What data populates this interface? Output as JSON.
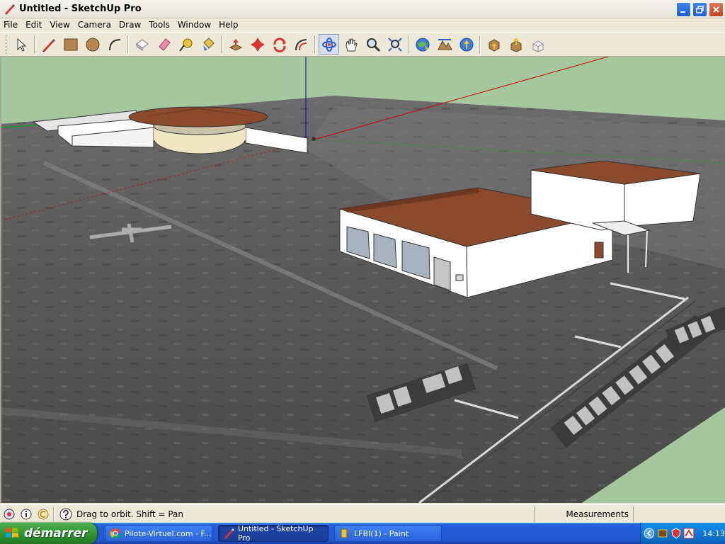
{
  "window": {
    "title": "Untitled - SketchUp Pro",
    "controls": [
      "minimize",
      "maximize",
      "close"
    ]
  },
  "menu": {
    "items": [
      "File",
      "Edit",
      "View",
      "Camera",
      "Draw",
      "Tools",
      "Window",
      "Help"
    ]
  },
  "toolbar": {
    "tools": [
      {
        "name": "select-icon"
      },
      {
        "name": "pencil-icon"
      },
      {
        "name": "rectangle-icon"
      },
      {
        "name": "circle-icon"
      },
      {
        "name": "arc-icon"
      },
      {
        "name": "eraser-icon"
      },
      {
        "name": "paint-eraser-icon"
      },
      {
        "name": "tape-measure-icon"
      },
      {
        "name": "paint-bucket-icon"
      },
      {
        "name": "push-pull-icon"
      },
      {
        "name": "move-icon"
      },
      {
        "name": "rotate-icon"
      },
      {
        "name": "offset-icon"
      },
      {
        "name": "orbit-icon"
      },
      {
        "name": "pan-icon"
      },
      {
        "name": "zoom-icon"
      },
      {
        "name": "zoom-extents-icon"
      },
      {
        "name": "get-current-view-icon"
      },
      {
        "name": "toggle-terrain-icon"
      },
      {
        "name": "place-model-icon"
      },
      {
        "name": "get-models-icon"
      },
      {
        "name": "share-model-icon"
      },
      {
        "name": "share-component-icon"
      }
    ],
    "active_tool": "orbit-icon"
  },
  "status": {
    "hint": "Drag to orbit.  Shift = Pan",
    "measurements_label": "Measurements",
    "measurements_value": ""
  },
  "taskbar": {
    "start_label": "démarrer",
    "tasks": [
      {
        "label": "Pilote-Virtuel.com - F...",
        "active": false
      },
      {
        "label": "Untitled - SketchUp Pro",
        "active": true
      },
      {
        "label": "LFBI(1) - Paint",
        "active": false
      }
    ],
    "clock": "14:13"
  },
  "colors": {
    "sky": "#a6c8a0",
    "roof": "#8b4a2b",
    "axis_red": "#cc0000",
    "axis_blue": "#0000cc",
    "axis_green": "#00aa00"
  }
}
